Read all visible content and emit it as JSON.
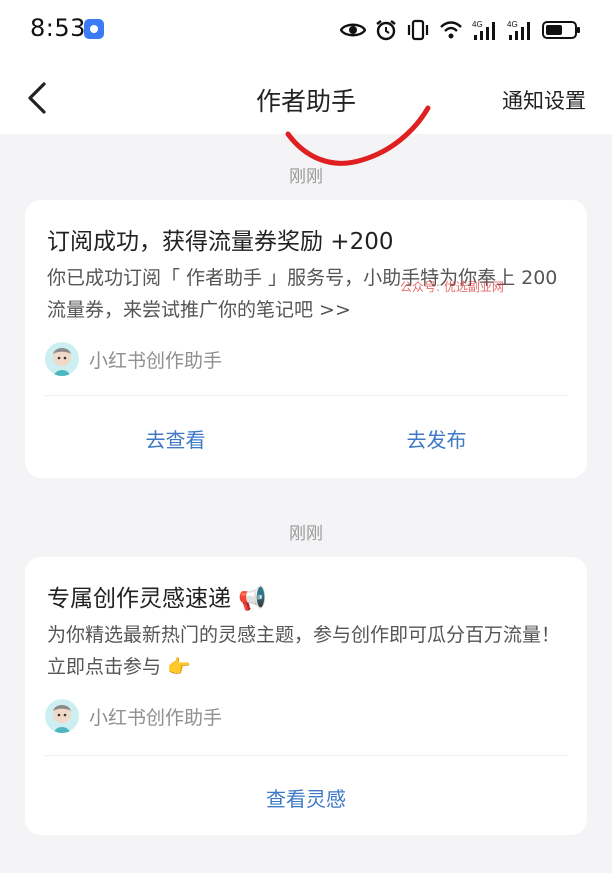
{
  "status_bar": {
    "time": "8:53",
    "icons": [
      "app-notification-icon",
      "eye-icon",
      "alarm-icon",
      "vibrate-icon",
      "wifi-icon",
      "signal-4g-icon",
      "signal-4g-icon",
      "battery-icon"
    ]
  },
  "header": {
    "back_icon": "chevron-left-icon",
    "title": "作者助手",
    "settings_label": "通知设置"
  },
  "messages": [
    {
      "time": "刚刚",
      "title": "订阅成功，获得流量券奖励 +200",
      "body": "你已成功订阅「 作者助手 」服务号，小助手特为你奉上 200 流量券，来尝试推广你的笔记吧 >>",
      "sender": "小红书创作助手",
      "actions": [
        "去查看",
        "去发布"
      ]
    },
    {
      "time": "刚刚",
      "title": "专属创作灵感速递 📢",
      "body": "为你精选最新热门的灵感主题，参与创作即可瓜分百万流量！ 立即点击参与 👉",
      "sender": "小红书创作助手",
      "actions": [
        "查看灵感"
      ]
    }
  ],
  "watermark": "公众号: 优选副业网",
  "colors": {
    "background": "#f4f4f6",
    "card": "#ffffff",
    "action_link": "#3d79c5",
    "timestamp": "#9a9a9a",
    "annotation": "#e02020"
  }
}
